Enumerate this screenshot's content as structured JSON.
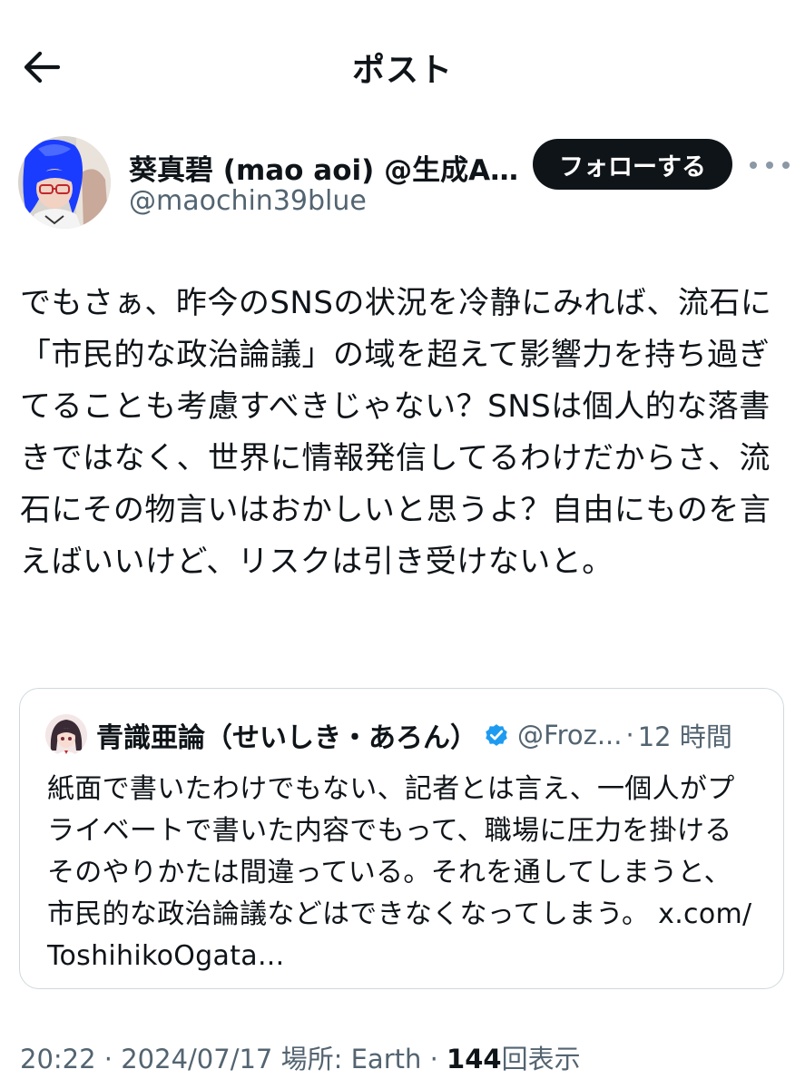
{
  "header": {
    "title": "ポスト"
  },
  "author": {
    "display_name": "葵真碧 (mao aoi) @生成AI...",
    "handle": "@maochin39blue",
    "follow_label": "フォローする"
  },
  "post": {
    "text": "でもさぁ、昨今のSNSの状況を冷静にみれば、流石に「市民的な政治論議」の域を超えて影響力を持ち過ぎてることも考慮すべきじゃない？SNSは個人的な落書きではなく、世界に情報発信してるわけだからさ、流石にその物言いはおかしいと思うよ？自由にものを言えばいいけど、リスクは引き受けないと。"
  },
  "quote": {
    "display_name": "青識亜論（せいしき・あろん）",
    "handle": "@Froz...",
    "separator": "·",
    "time": "12 時間",
    "text": "紙面で書いたわけでもない、記者とは言え、一個人がプライベートで書いた内容でもって、職場に圧力を掛けるそのやりかたは間違っている。それを通してしまうと、市民的な政治論議などはできなくなってしまう。",
    "link": "x.com/ToshihikoOgata..."
  },
  "meta": {
    "time": "20:22",
    "sep1": "·",
    "date": "2024/07/17",
    "location": "場所: Earth",
    "sep2": "·",
    "views_count": "144",
    "views_label": "回表示"
  },
  "icons": {
    "back": "arrow-left-icon",
    "more": "more-horizontal-icon",
    "verified": "verified-badge-icon"
  },
  "colors": {
    "text_primary": "#0f1419",
    "text_secondary": "#536471",
    "follow_button_bg": "#0f1419",
    "verified_blue": "#1d9bf0",
    "border": "#cfd9de"
  }
}
